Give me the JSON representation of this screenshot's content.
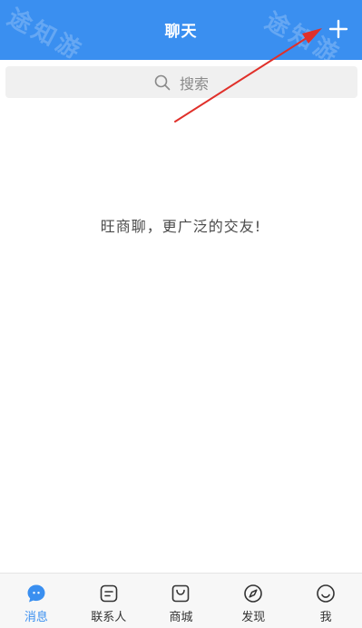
{
  "header": {
    "title": "聊天",
    "add_icon": "plus-icon",
    "watermark": "途知游"
  },
  "search": {
    "placeholder": "搜索",
    "icon": "search-icon"
  },
  "empty_state": {
    "message": "旺商聊，更广泛的交友!"
  },
  "colors": {
    "brand": "#3a8ff0",
    "annotation": "#e0302a"
  },
  "tabbar": {
    "tabs": [
      {
        "label": "消息",
        "icon": "chat-bubble-icon",
        "active": true
      },
      {
        "label": "联系人",
        "icon": "contacts-icon",
        "active": false
      },
      {
        "label": "商城",
        "icon": "shopping-bag-icon",
        "active": false
      },
      {
        "label": "发现",
        "icon": "compass-icon",
        "active": false
      },
      {
        "label": "我",
        "icon": "smiley-icon",
        "active": false
      }
    ]
  }
}
